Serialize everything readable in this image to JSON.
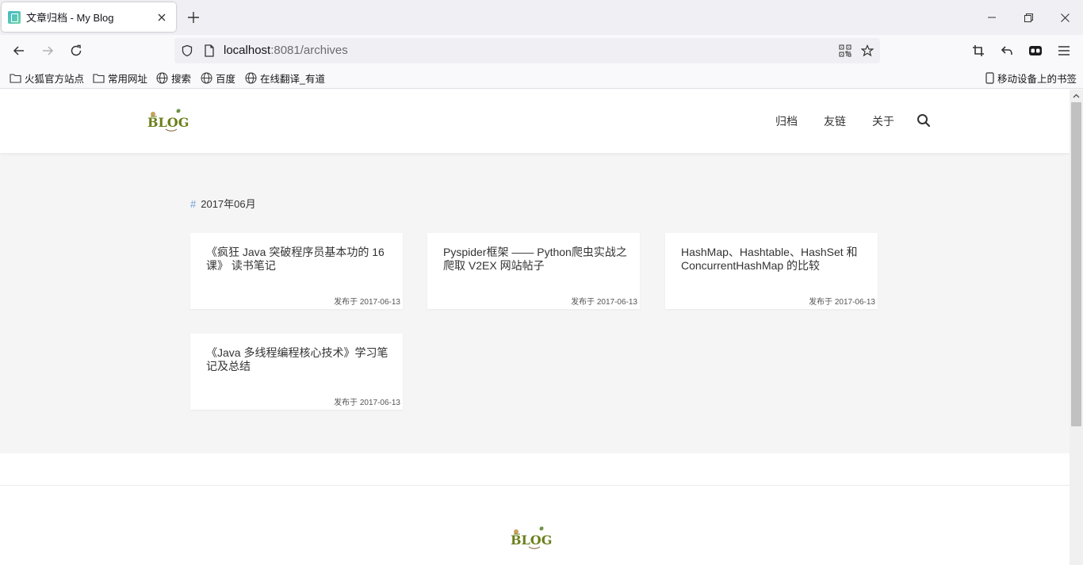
{
  "browser": {
    "tab_title": "文章归档 - My Blog",
    "url_host": "localhost",
    "url_rest": ":8081/archives",
    "bookmarks": [
      "火狐官方站点",
      "常用网址",
      "搜索",
      "百度",
      "在线翻译_有道"
    ],
    "mobile_bookmarks": "移动设备上的书签"
  },
  "site": {
    "logo_text": "BLOG",
    "nav": [
      "归档",
      "友链",
      "关于"
    ]
  },
  "archive": {
    "hash": "#",
    "month": "2017年06月",
    "posts": [
      {
        "title": "《疯狂 Java 突破程序员基本功的 16 课》 读书笔记",
        "date": "发布于 2017-06-13"
      },
      {
        "title": "Pyspider框架 —— Python爬虫实战之爬取 V2EX 网站帖子",
        "date": "发布于 2017-06-13"
      },
      {
        "title": "HashMap、Hashtable、HashSet 和 ConcurrentHashMap 的比较",
        "date": "发布于 2017-06-13"
      },
      {
        "title": "《Java 多线程编程核心技术》学习笔记及总结",
        "date": "发布于 2017-06-13"
      }
    ]
  },
  "icons": {
    "back": "arrow-left-icon",
    "forward": "arrow-right-icon",
    "reload": "reload-icon",
    "shield": "shield-icon",
    "page": "page-icon",
    "qr": "qr-code-icon",
    "star": "star-icon",
    "crop": "screenshot-icon",
    "undo": "undo-icon",
    "extension": "extension-icon",
    "menu": "menu-icon",
    "search": "search-icon"
  }
}
